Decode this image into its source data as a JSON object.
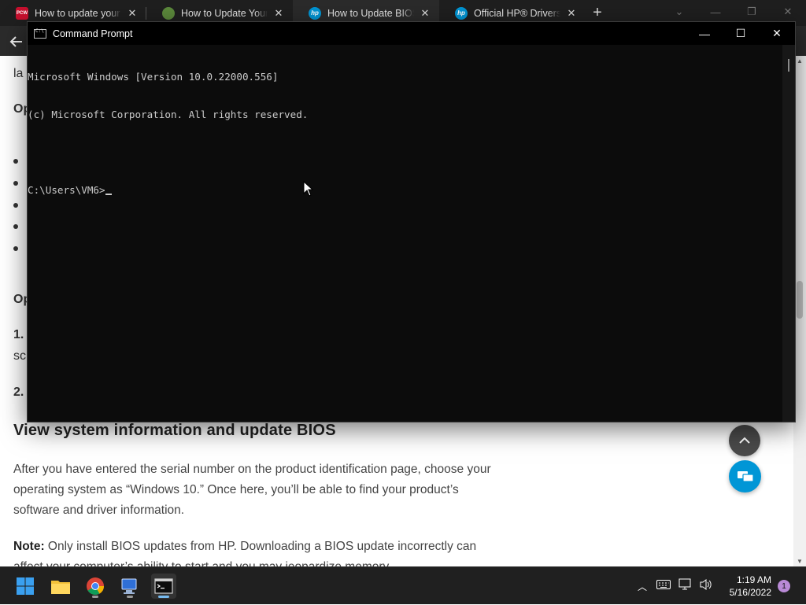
{
  "browser": {
    "tabs": [
      {
        "title": "How to update your PC",
        "favicon_text": "PCW",
        "favicon_color": "#c8102e",
        "active": false
      },
      {
        "title": "How to Update Your Computer",
        "favicon_text": "",
        "favicon_color": "#5c8a3c",
        "active": false
      },
      {
        "title": "How to Update BIOS Safely",
        "favicon_text": "hp",
        "favicon_color": "#0096d6",
        "active": true
      },
      {
        "title": "Official HP® Drivers and Software",
        "favicon_text": "hp",
        "favicon_color": "#0096d6",
        "active": false
      }
    ],
    "new_tab_icon": "plus-icon"
  },
  "page": {
    "fragments": [
      {
        "text": "la",
        "weight": "normal"
      },
      {
        "text": "Op",
        "weight": "bold"
      },
      {
        "text": "Op",
        "weight": "bold"
      },
      {
        "text": "1.",
        "weight": "bold"
      },
      {
        "text": "sc",
        "weight": "normal"
      },
      {
        "text": "2.",
        "weight": "bold"
      }
    ],
    "heading": "View system information and update BIOS",
    "paragraph1": "After you have entered the serial number on the product identification page, choose your operating system as “Windows 10.” Once here, you’ll be able to find your product’s software and driver information.",
    "note_label": "Note:",
    "note_text": " Only install BIOS updates from HP. Downloading a BIOS update incorrectly can affect your computer’s ability to start and you may jeopardize memory"
  },
  "cmd": {
    "title": "Command Prompt",
    "lines": [
      "Microsoft Windows [Version 10.0.22000.556]",
      "(c) Microsoft Corporation. All rights reserved.",
      "",
      "C:\\Users\\VM6>"
    ]
  },
  "taskbar": {
    "apps": [
      "start-icon",
      "file-explorer-icon",
      "chrome-icon",
      "network-app-icon",
      "command-prompt-icon"
    ],
    "clock_time": "1:19 AM",
    "clock_date": "5/16/2022",
    "notification_count": "1"
  }
}
